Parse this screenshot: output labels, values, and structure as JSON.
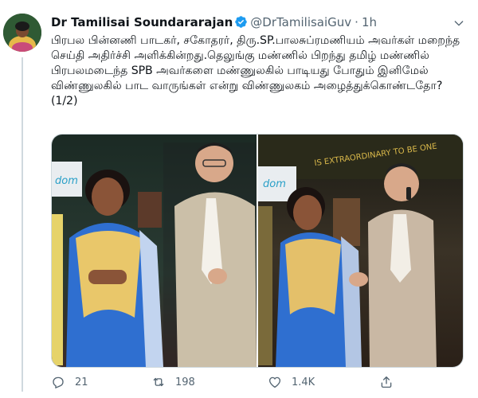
{
  "tweet": {
    "author_name": "Dr Tamilisai Soundararajan",
    "handle": "@DrTamilisaiGuv",
    "separator": "·",
    "time": "1h",
    "text": "பிரபல பின்னணி பாடகர், சகோதரர், திரு.SP.பாலசுப்ரமணியம் அவர்கள் மறைந்த செய்தி அதிர்ச்சி அளிக்கின்றது.தெலுங்கு மண்ணில் பிறந்து தமிழ் மண்ணில் பிரபலமடைந்த SPB அவர்களை மண்ணுலகில் பாடியது போதும் இனிமேல் விண்ணுலகில் பாட வாருங்கள் என்று விண்ணுலகம் அழைத்துக்கொண்டதோ? (1/2)"
  },
  "media": {
    "photos": [
      {
        "id": "photo-1",
        "banner_text": "dom",
        "stage_text": ""
      },
      {
        "id": "photo-2",
        "banner_text": "dom",
        "stage_text": "IS EXTRAORDINARY TO BE ONE"
      }
    ]
  },
  "actions": {
    "reply_count": "21",
    "retweet_count": "198",
    "like_count": "1.4K",
    "share_label": ""
  },
  "colors": {
    "text_primary": "#0f1419",
    "text_secondary": "#536471",
    "verified_blue": "#1d9bf0",
    "border": "#cfd9de"
  },
  "icons": [
    "reply-icon",
    "retweet-icon",
    "like-icon",
    "share-icon",
    "verified-icon",
    "chevron-down-icon"
  ]
}
